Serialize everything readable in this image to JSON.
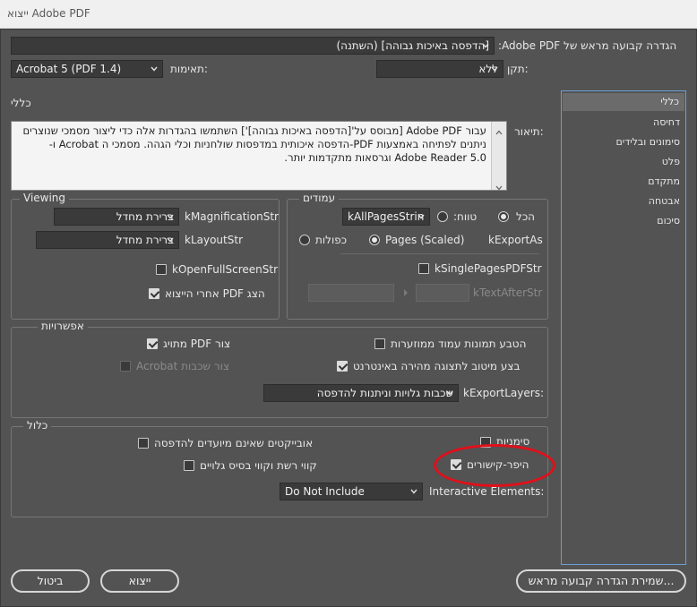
{
  "window": {
    "title": "ייצוא Adobe PDF"
  },
  "top": {
    "preset_label": "הגדרה קבועה מראש של Adobe PDF:",
    "preset_value": "[הדפסה באיכות גבוהה] (השתנה)",
    "compat_label": "תאימות:",
    "compat_value": "Acrobat 5 (PDF 1.4)",
    "standard_label": "תקן:",
    "standard_value": "ללא"
  },
  "section_title": "כללי",
  "description": {
    "label": "תיאור:",
    "text": "עבור Adobe PDF [מבוסס על'[הדפסה באיכות גבוהה]'] השתמשו בהגדרות אלה כדי ליצור מסמכי שנוצרים ניתנים לפתיחה באמצעות PDF-הדפסה איכותית במדפסות שולחניות וכלי הגהה. מסמכי ה Acrobat ו-Adobe Reader 5.0 וגרסאות מתקדמות יותר."
  },
  "sidebar": {
    "items": [
      {
        "label": "כללי"
      },
      {
        "label": "דחיסה"
      },
      {
        "label": "סימונים ובלידים"
      },
      {
        "label": "פלט"
      },
      {
        "label": "מתקדם"
      },
      {
        "label": "אבטחה"
      },
      {
        "label": "סיכום"
      }
    ]
  },
  "pages": {
    "title": "עמודים",
    "all_label": "הכל",
    "range_label": "טווח:",
    "range_value": "kAllPagesStrin",
    "export_as_label": "kExportAs",
    "pages_option": "Pages (Scaled)",
    "spreads_option": "כפולות",
    "single_pages_label": "kSinglePagesPDFStr",
    "text_after_label": "kTextAfterStr"
  },
  "viewing": {
    "title": "Viewing",
    "magnification_label": "kMagnificationStr",
    "magnification_value": "ברירת מחדל",
    "layout_label": "kLayoutStr",
    "layout_value": "ברירת מחדל",
    "fullscreen_label": "kOpenFullScreenStr",
    "view_after_export_label": "הצג PDF אחרי הייצוא"
  },
  "options": {
    "title": "אפשרויות",
    "embed_thumbnails_label": "הטבע תמונות עמוד ממוזערות",
    "optimize_label": "בצע מיטוב לתצוגה מהירה באינטרנט",
    "tagged_pdf_label": "צור PDF מתויג",
    "acrobat_layers_label": "צור שכבות Acrobat",
    "export_layers_label": "kExportLayers:",
    "export_layers_value": "שכבות גלויות וניתנות להדפסה"
  },
  "include": {
    "title": "כלול",
    "bookmarks_label": "סימניות",
    "hyperlinks_label": "היפר-קישורים",
    "nonprinting_label": "אובייקטים שאינם מיועדים להדפסה",
    "guides_label": "קווי רשת וקווי בסיס גלויים",
    "interactive_label": "Interactive Elements:",
    "interactive_value": "Do Not Include"
  },
  "buttons": {
    "save_preset": "שמירת הגדרה קבועה מראש...",
    "export": "ייצוא",
    "cancel": "ביטול"
  },
  "colors": {
    "annotation_circle": "#e0101a",
    "list_border": "#6aa0d8"
  }
}
